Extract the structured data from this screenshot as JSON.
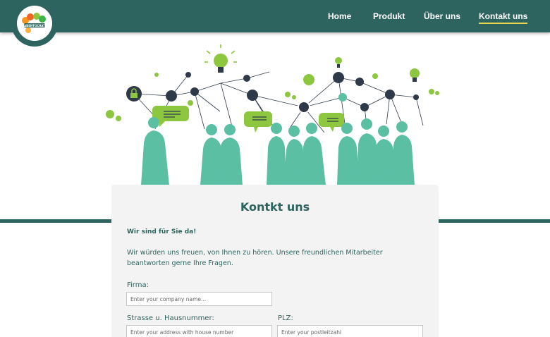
{
  "header": {
    "logo_alt": "ABENTOCRAT",
    "nav": [
      {
        "label": "Home",
        "active": false
      },
      {
        "label": "Produkt",
        "active": false
      },
      {
        "label": "Über uns",
        "active": false
      },
      {
        "label": "Kontakt uns",
        "active": true
      }
    ]
  },
  "contact": {
    "title": "Kontkt uns",
    "subtitle": "Wir sind für Sie da!",
    "intro": "Wir würden uns freuen, von Ihnen zu hören. Unsere freundlichen Mitarbeiter beantworten gerne Ihre Fragen.",
    "company_label": "Firma:",
    "company_placeholder": "Enter your company name...",
    "street_label": "Strasse u. Hausnummer:",
    "street_placeholder": "Enter your address with house number",
    "zip_label": "PLZ:",
    "zip_placeholder": "Enter your postleitzahl"
  },
  "colors": {
    "primary": "#2e6460",
    "accent_green": "#8dc63f",
    "people": "#5bbfa4",
    "nav_underline": "#e8d84a"
  }
}
